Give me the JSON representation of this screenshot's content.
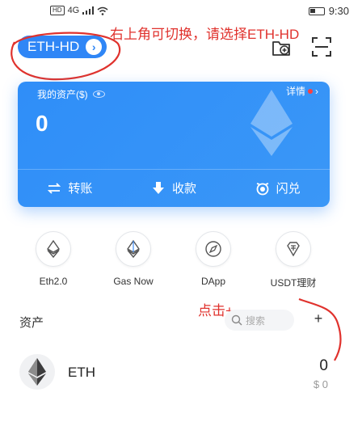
{
  "status_bar": {
    "left_badge": "HD",
    "network": "4G",
    "time": "9:30"
  },
  "header": {
    "wallet_label": "ETH-HD",
    "annotation": "右上角可切换，请选择ETH-HD"
  },
  "card": {
    "asset_label": "我的资产($)",
    "details_label": "详情",
    "balance": "0",
    "actions": [
      {
        "label": "转账",
        "icon": "transfer-icon"
      },
      {
        "label": "收款",
        "icon": "receive-icon"
      },
      {
        "label": "闪兑",
        "icon": "swap-icon"
      }
    ]
  },
  "apps": [
    {
      "label": "Eth2.0",
      "icon": "eth2-icon"
    },
    {
      "label": "Gas Now",
      "icon": "gas-now-icon"
    },
    {
      "label": "DApp",
      "icon": "compass-icon"
    },
    {
      "label": "USDT理财",
      "icon": "usdt-icon"
    }
  ],
  "assets": {
    "title": "资产",
    "search_placeholder": "搜索",
    "add_label": "+",
    "annotation": "点击+",
    "items": [
      {
        "name": "ETH",
        "amount": "0",
        "value": "$ 0"
      }
    ]
  },
  "colors": {
    "primary": "#2f86f6",
    "annotation_red": "#e0322d"
  }
}
